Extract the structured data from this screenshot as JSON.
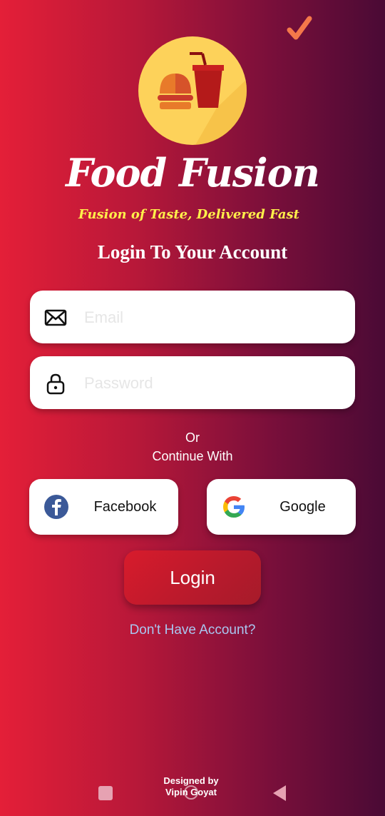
{
  "app": {
    "name": "Food Fusion",
    "tagline": "Fusion of Taste, Delivered Fast",
    "heading": "Login To Your Account"
  },
  "form": {
    "email": {
      "value": "",
      "placeholder": "Email",
      "icon": "envelope-icon"
    },
    "password": {
      "value": "",
      "placeholder": "Password",
      "icon": "lock-icon"
    }
  },
  "divider": {
    "or": "Or",
    "continue": "Continue With"
  },
  "social": {
    "facebook": {
      "label": "Facebook",
      "icon": "facebook-icon",
      "color": "#3b5998"
    },
    "google": {
      "label": "Google",
      "icon": "google-icon"
    }
  },
  "actions": {
    "login": "Login",
    "signup_link": "Don't Have Account?"
  },
  "footer": {
    "designed_by": "Designed by",
    "designer": "Vipin Goyat"
  },
  "colors": {
    "gradient_start": "#e41f38",
    "gradient_end": "#4a0a35",
    "tagline": "#fff04a",
    "link": "#a9c6f0"
  }
}
